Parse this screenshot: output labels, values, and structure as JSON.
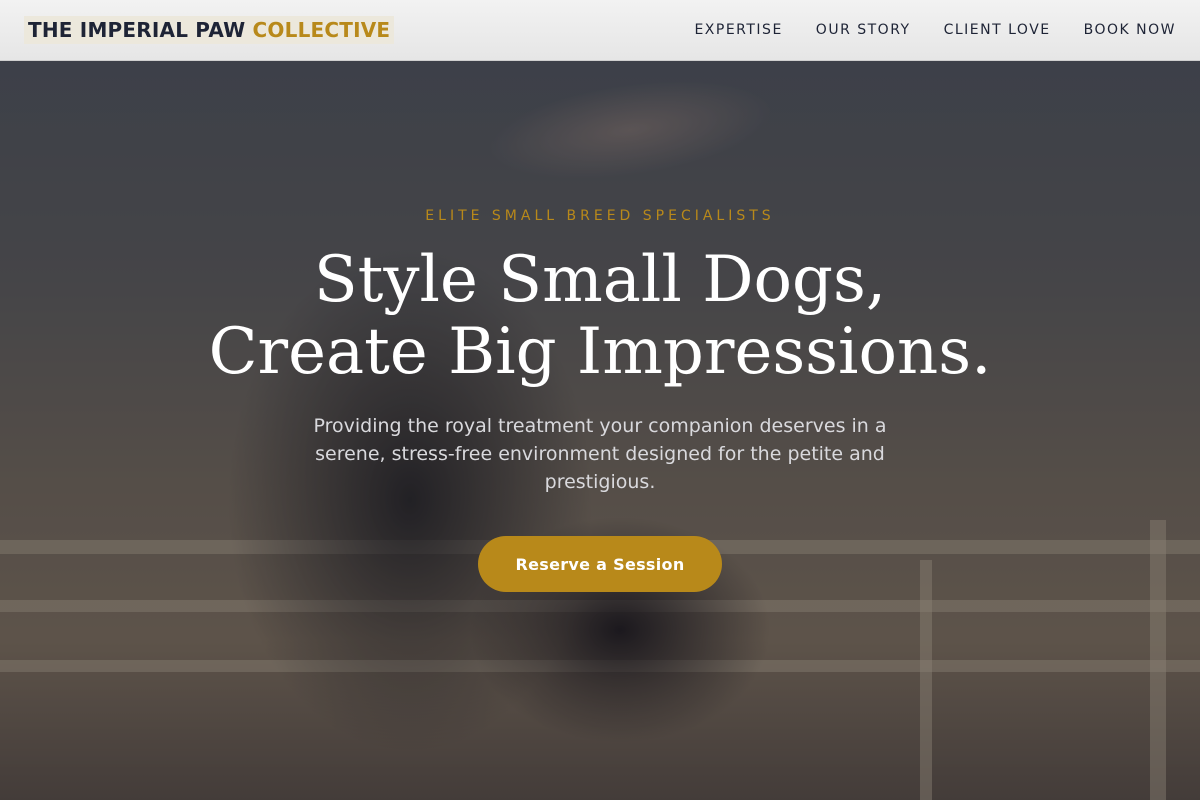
{
  "header": {
    "brand_main": "THE IMPERIAL PAW",
    "brand_accent": "COLLECTIVE",
    "nav": [
      {
        "label": "EXPERTISE"
      },
      {
        "label": "OUR STORY"
      },
      {
        "label": "CLIENT LOVE"
      },
      {
        "label": "BOOK NOW"
      }
    ]
  },
  "hero": {
    "eyebrow": "ELITE SMALL BREED SPECIALISTS",
    "headline_line1": "Style Small Dogs,",
    "headline_line2": "Create Big Impressions.",
    "subtitle": "Providing the royal treatment your companion deserves in a serene, stress-free environment designed for the petite and prestigious.",
    "cta_label": "Reserve a Session"
  },
  "colors": {
    "accent": "#b8891a",
    "navy": "#1e2436",
    "header_bg": "#efefef"
  }
}
